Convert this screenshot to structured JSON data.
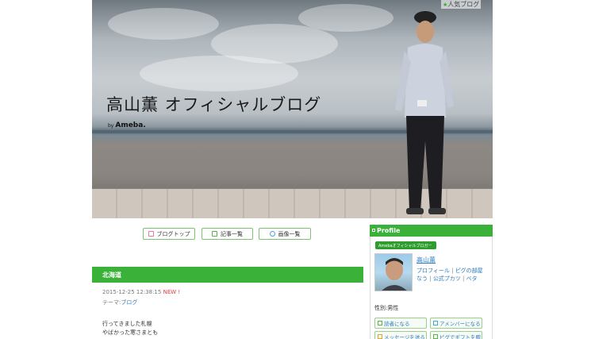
{
  "header": {
    "title": "高山薫 オフィシャルブログ",
    "by": "by",
    "brand": "Ameba.",
    "popular_label": "人気ブログ"
  },
  "nav": {
    "blog_top": "ブログトップ",
    "entries": "記事一覧",
    "images": "画像一覧"
  },
  "article": {
    "title": "北海道",
    "datetime": "2015-12-25 12:38:15",
    "new_label": "NEW !",
    "theme_label": "テーマ:",
    "theme_link": "ブログ",
    "body": [
      "行ってきました札幌",
      "やばかった寒さまとも"
    ]
  },
  "sidebar": {
    "header": "Profile",
    "badge": "Amebaオフィシャルブロガー",
    "name": "高山薫",
    "links": [
      "プロフィール",
      "ピグの部屋",
      "なう",
      "公式プカツ",
      "ベタ"
    ],
    "gender": "性別:男性",
    "buttons": [
      "読者になる",
      "アメンバーになる",
      "メッセージを送る",
      "ピグでギフトを贈"
    ]
  },
  "colors": {
    "accent_green": "#3ab23a",
    "link_blue": "#2a7bbf",
    "new_red": "#e3393a"
  }
}
